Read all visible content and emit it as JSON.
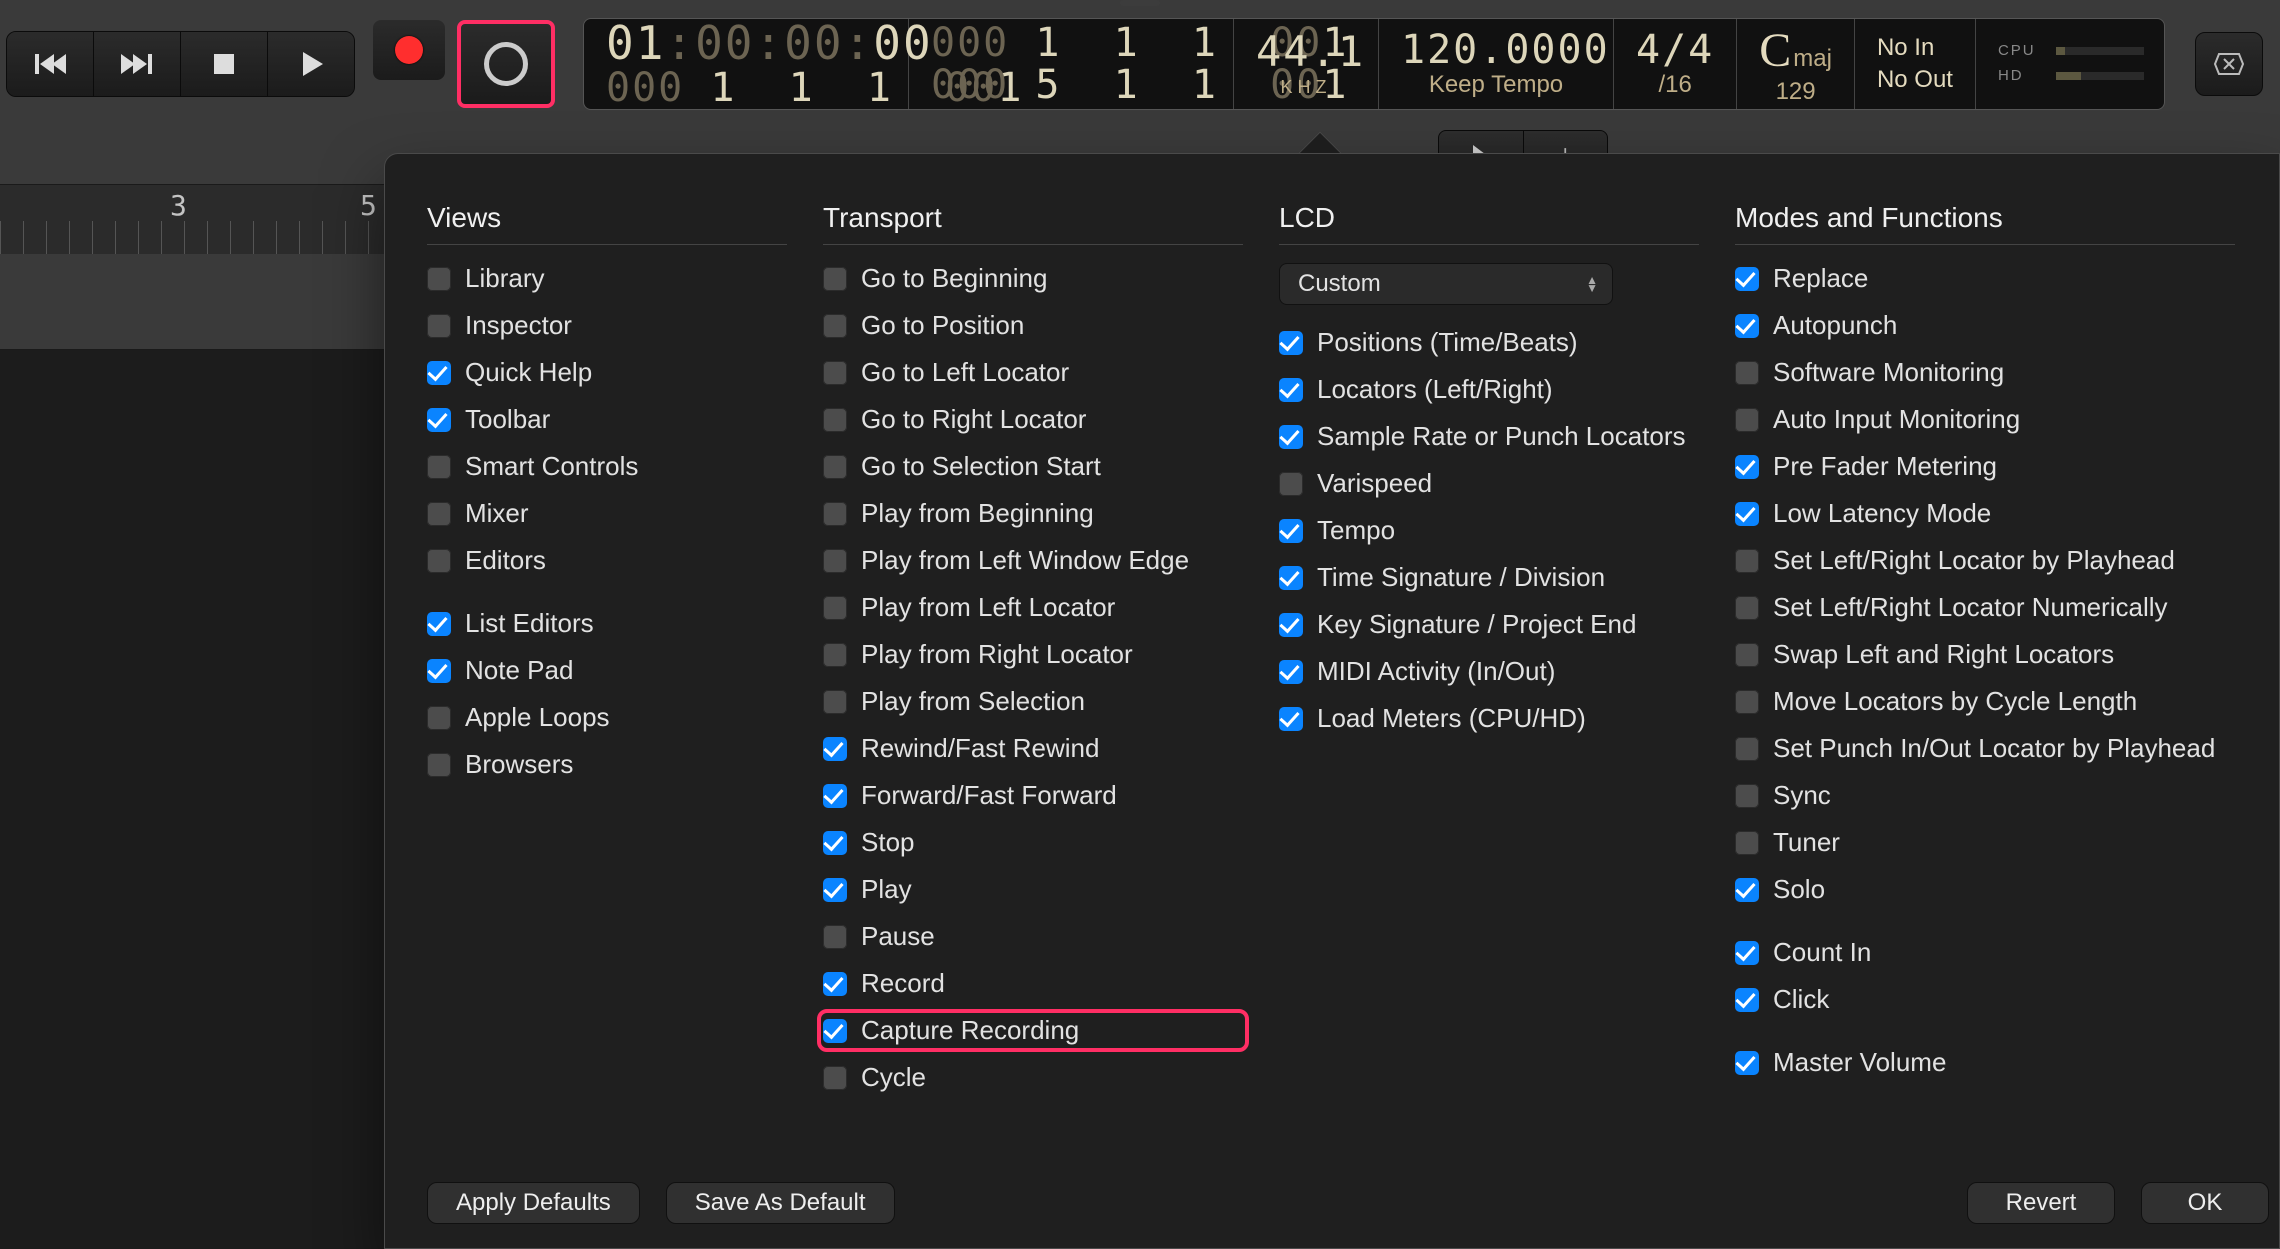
{
  "transport_bar": {
    "icons": {
      "rewind": "rewind",
      "forward": "forward",
      "stop": "stop",
      "play": "play"
    }
  },
  "lcd_display": {
    "position_time": {
      "hours": "01",
      "leadzeros": ":00:00:",
      "frames": "00"
    },
    "position_sub": {
      "dim1": "000",
      "n1": "1",
      "n2": "1",
      "n3": "1",
      "dim2": "00",
      "n4": "1"
    },
    "beats_top": {
      "dim1": "000",
      "n1": "1",
      "n2": "1",
      "n3": "1",
      "dim2": "00",
      "n4": "1"
    },
    "beats_bot": {
      "dim1": "000",
      "n1": "5",
      "n2": "1",
      "n3": "1",
      "dim2": "00",
      "n4": "1"
    },
    "sample_rate": "44.1",
    "sample_rate_unit": "KHZ",
    "tempo": "120.0000",
    "tempo_mode": "Keep Tempo",
    "timesig_top": "4/4",
    "timesig_bot": "/16",
    "key_root": "C",
    "key_mode": "maj",
    "key_sub": "129",
    "punch_in": "No In",
    "punch_out": "No Out",
    "meters": {
      "cpu_label": "CPU",
      "hd_label": "HD"
    }
  },
  "ruler": {
    "marker_a": "3",
    "marker_b": "5"
  },
  "panel": {
    "lcd_dropdown": "Custom",
    "sections": {
      "views": {
        "title": "Views",
        "items": [
          {
            "label": "Library",
            "checked": false
          },
          {
            "label": "Inspector",
            "checked": false
          },
          {
            "label": "Quick Help",
            "checked": true
          },
          {
            "label": "Toolbar",
            "checked": true
          },
          {
            "label": "Smart Controls",
            "checked": false
          },
          {
            "label": "Mixer",
            "checked": false
          },
          {
            "label": "Editors",
            "checked": false
          },
          {
            "label": "List Editors",
            "checked": true,
            "gap": true
          },
          {
            "label": "Note Pad",
            "checked": true
          },
          {
            "label": "Apple Loops",
            "checked": false
          },
          {
            "label": "Browsers",
            "checked": false
          }
        ]
      },
      "transport": {
        "title": "Transport",
        "items": [
          {
            "label": "Go to Beginning",
            "checked": false
          },
          {
            "label": "Go to Position",
            "checked": false
          },
          {
            "label": "Go to Left Locator",
            "checked": false
          },
          {
            "label": "Go to Right Locator",
            "checked": false
          },
          {
            "label": "Go to Selection Start",
            "checked": false
          },
          {
            "label": "Play from Beginning",
            "checked": false
          },
          {
            "label": "Play from Left Window Edge",
            "checked": false
          },
          {
            "label": "Play from Left Locator",
            "checked": false
          },
          {
            "label": "Play from Right Locator",
            "checked": false
          },
          {
            "label": "Play from Selection",
            "checked": false
          },
          {
            "label": "Rewind/Fast Rewind",
            "checked": true
          },
          {
            "label": "Forward/Fast Forward",
            "checked": true
          },
          {
            "label": "Stop",
            "checked": true
          },
          {
            "label": "Play",
            "checked": true
          },
          {
            "label": "Pause",
            "checked": false
          },
          {
            "label": "Record",
            "checked": true
          },
          {
            "label": "Capture Recording",
            "checked": true,
            "highlight": true
          },
          {
            "label": "Cycle",
            "checked": false
          }
        ]
      },
      "lcd": {
        "title": "LCD",
        "items": [
          {
            "label": "Positions (Time/Beats)",
            "checked": true
          },
          {
            "label": "Locators (Left/Right)",
            "checked": true
          },
          {
            "label": "Sample Rate or Punch Locators",
            "checked": true
          },
          {
            "label": "Varispeed",
            "checked": false
          },
          {
            "label": "Tempo",
            "checked": true
          },
          {
            "label": "Time Signature / Division",
            "checked": true
          },
          {
            "label": "Key Signature / Project End",
            "checked": true
          },
          {
            "label": "MIDI Activity (In/Out)",
            "checked": true
          },
          {
            "label": "Load Meters (CPU/HD)",
            "checked": true
          }
        ]
      },
      "modes": {
        "title": "Modes and Functions",
        "items": [
          {
            "label": "Replace",
            "checked": true
          },
          {
            "label": "Autopunch",
            "checked": true
          },
          {
            "label": "Software Monitoring",
            "checked": false
          },
          {
            "label": "Auto Input Monitoring",
            "checked": false
          },
          {
            "label": "Pre Fader Metering",
            "checked": true
          },
          {
            "label": "Low Latency Mode",
            "checked": true
          },
          {
            "label": "Set Left/Right Locator by Playhead",
            "checked": false
          },
          {
            "label": "Set Left/Right Locator Numerically",
            "checked": false
          },
          {
            "label": "Swap Left and Right Locators",
            "checked": false
          },
          {
            "label": "Move Locators by Cycle Length",
            "checked": false
          },
          {
            "label": "Set Punch In/Out Locator by Playhead",
            "checked": false
          },
          {
            "label": "Sync",
            "checked": false
          },
          {
            "label": "Tuner",
            "checked": false
          },
          {
            "label": "Solo",
            "checked": true
          },
          {
            "label": "Count In",
            "checked": true,
            "gap": true
          },
          {
            "label": "Click",
            "checked": true
          },
          {
            "label": "Master Volume",
            "checked": true,
            "gap": true
          }
        ]
      }
    },
    "buttons": {
      "apply_defaults": "Apply Defaults",
      "save_as_default": "Save As Default",
      "revert": "Revert",
      "ok": "OK"
    }
  }
}
